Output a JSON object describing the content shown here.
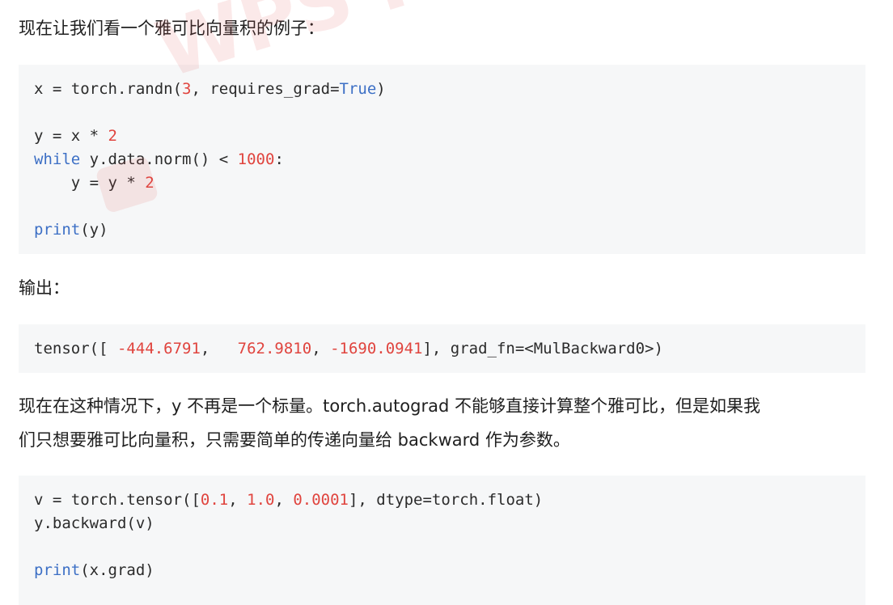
{
  "intro": "现在让我们看一个雅可比向量积的例子：",
  "code1": [
    [
      {
        "t": "x = torch.randn("
      },
      {
        "t": "3",
        "c": "num"
      },
      {
        "t": ", requires_grad="
      },
      {
        "t": "True",
        "c": "kw"
      },
      {
        "t": ")"
      }
    ],
    [],
    [
      {
        "t": "y = x * "
      },
      {
        "t": "2",
        "c": "num"
      }
    ],
    [
      {
        "t": "while",
        "c": "kw"
      },
      {
        "t": " y.data.norm() < "
      },
      {
        "t": "1000",
        "c": "num"
      },
      {
        "t": ":"
      }
    ],
    [
      {
        "t": "    y = y * "
      },
      {
        "t": "2",
        "c": "num"
      }
    ],
    [],
    [
      {
        "t": "print",
        "c": "kw"
      },
      {
        "t": "(y)"
      }
    ]
  ],
  "output_label": "输出：",
  "code2": [
    [
      {
        "t": "tensor([ "
      },
      {
        "t": "-444.6791",
        "c": "num"
      },
      {
        "t": ",   "
      },
      {
        "t": "762.9810",
        "c": "num"
      },
      {
        "t": ", "
      },
      {
        "t": "-1690.0941",
        "c": "num"
      },
      {
        "t": "], grad_fn=<MulBackward0>)"
      }
    ]
  ],
  "explanation_line1": "现在在这种情况下，y 不再是一个标量。torch.autograd 不能够直接计算整个雅可比，但是如果我",
  "explanation_line2": "们只想要雅可比向量积，只需要简单的传递向量给 backward 作为参数。",
  "code3": [
    [
      {
        "t": "v = torch.tensor(["
      },
      {
        "t": "0.1",
        "c": "num"
      },
      {
        "t": ", "
      },
      {
        "t": "1.0",
        "c": "num"
      },
      {
        "t": ", "
      },
      {
        "t": "0.0001",
        "c": "num"
      },
      {
        "t": "], dtype=torch.float)"
      }
    ],
    [
      {
        "t": "y.backward(v)"
      }
    ],
    [],
    [
      {
        "t": "print",
        "c": "kw"
      },
      {
        "t": "(x.grad)"
      }
    ]
  ],
  "watermark": "WPS PDF编辑",
  "colors": {
    "number": "#e0443e",
    "keyword": "#3c6fc5",
    "code_bg": "#f6f7f8"
  }
}
